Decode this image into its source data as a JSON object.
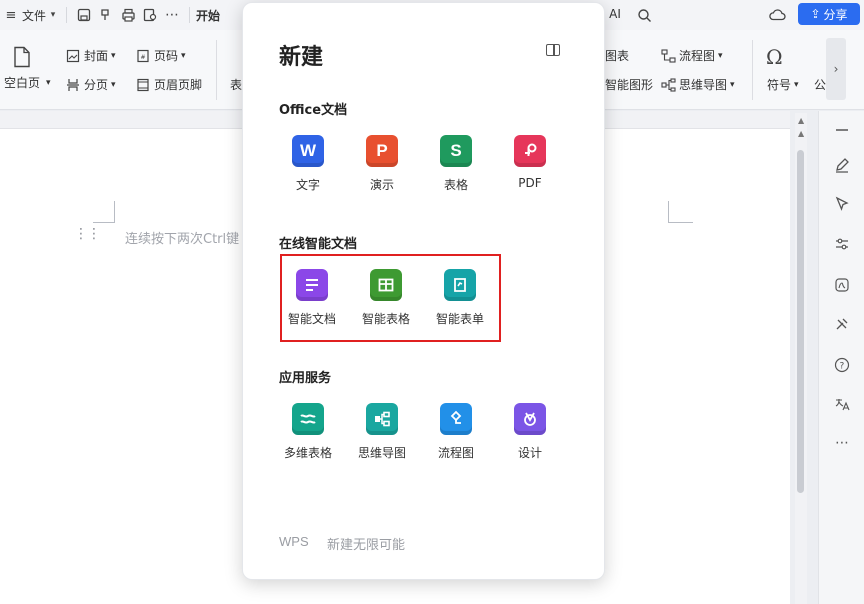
{
  "topbar": {
    "menu_file": "文件",
    "tab_start_partial": "开始",
    "ai_label_partial": "G AI",
    "share_label": "分享"
  },
  "ribbon": {
    "blank_page": "空白页",
    "cover": "封面",
    "page_break": "分页",
    "page_number": "页码",
    "header_footer": "页眉页脚",
    "table_partial": "表",
    "chart_partial": "图表",
    "smart_shape_partial": "智能图形",
    "flowchart": "流程图",
    "mindmap": "思维导图",
    "symbol": "符号",
    "formula_partial": "公"
  },
  "document": {
    "hint_text": "连续按下两次Ctrl键"
  },
  "popup": {
    "title": "新建",
    "sections": {
      "office": {
        "title": "Office文档",
        "items": [
          {
            "label": "文字",
            "glyph": "W",
            "color": "#2f63e6",
            "icon": "word-icon"
          },
          {
            "label": "演示",
            "glyph": "P",
            "color": "#e8502f",
            "icon": "presentation-icon"
          },
          {
            "label": "表格",
            "glyph": "S",
            "color": "#1f9a5e",
            "icon": "spreadsheet-icon"
          },
          {
            "label": "PDF",
            "glyph": "",
            "color": "#e6365a",
            "icon": "pdf-icon"
          }
        ]
      },
      "online": {
        "title": "在线智能文档",
        "items": [
          {
            "label": "智能文档",
            "color": "#8b47e8",
            "icon": "smart-doc-icon"
          },
          {
            "label": "智能表格",
            "color": "#3e9a32",
            "icon": "smart-sheet-icon"
          },
          {
            "label": "智能表单",
            "color": "#16a4a8",
            "icon": "smart-form-icon"
          }
        ]
      },
      "services": {
        "title": "应用服务",
        "items": [
          {
            "label": "多维表格",
            "color": "#14a58c",
            "icon": "multi-table-icon"
          },
          {
            "label": "思维导图",
            "color": "#1aa7a0",
            "icon": "mindmap-icon"
          },
          {
            "label": "流程图",
            "color": "#2290e8",
            "icon": "flowchart-icon"
          },
          {
            "label": "设计",
            "color": "#7b55e6",
            "icon": "design-icon"
          }
        ]
      }
    },
    "footer_brand": "WPS",
    "footer_slogan": "新建无限可能"
  }
}
